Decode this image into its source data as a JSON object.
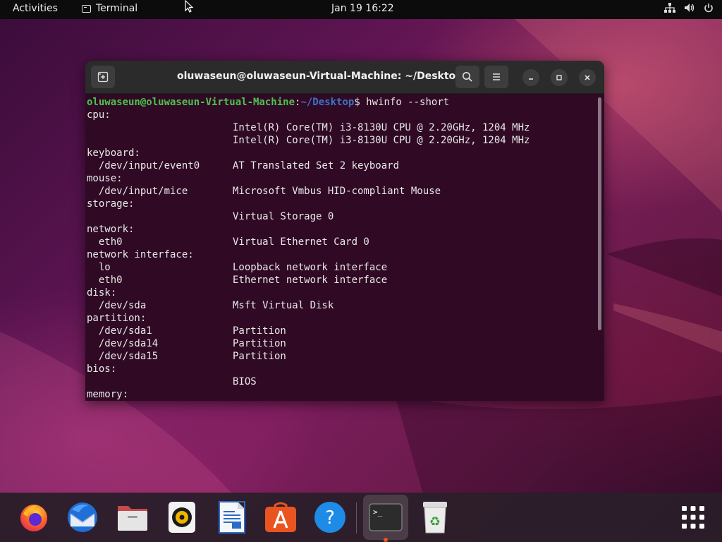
{
  "topbar": {
    "activities": "Activities",
    "app_name": "Terminal",
    "clock": "Jan 19  16:22",
    "tray_icons": [
      "network-icon",
      "volume-icon",
      "power-icon"
    ]
  },
  "window": {
    "title": "oluwaseun@oluwaseun-Virtual-Machine: ~/Desktop"
  },
  "terminal": {
    "prompt_user": "oluwaseun@oluwaseun-Virtual-Machine",
    "prompt_sep": ":",
    "prompt_path": "~/Desktop",
    "prompt_sym": "$ ",
    "command": "hwinfo --short",
    "lines": [
      {
        "device": "cpu:",
        "desc": ""
      },
      {
        "device": "",
        "desc": "Intel(R) Core(TM) i3-8130U CPU @ 2.20GHz, 1204 MHz"
      },
      {
        "device": "",
        "desc": "Intel(R) Core(TM) i3-8130U CPU @ 2.20GHz, 1204 MHz"
      },
      {
        "device": "keyboard:",
        "desc": ""
      },
      {
        "device": "  /dev/input/event0",
        "desc": "AT Translated Set 2 keyboard"
      },
      {
        "device": "mouse:",
        "desc": ""
      },
      {
        "device": "  /dev/input/mice",
        "desc": "Microsoft Vmbus HID-compliant Mouse"
      },
      {
        "device": "storage:",
        "desc": ""
      },
      {
        "device": "",
        "desc": "Virtual Storage 0"
      },
      {
        "device": "network:",
        "desc": ""
      },
      {
        "device": "  eth0",
        "desc": "Virtual Ethernet Card 0"
      },
      {
        "device": "network interface:",
        "desc": ""
      },
      {
        "device": "  lo",
        "desc": "Loopback network interface"
      },
      {
        "device": "  eth0",
        "desc": "Ethernet network interface"
      },
      {
        "device": "disk:",
        "desc": ""
      },
      {
        "device": "  /dev/sda",
        "desc": "Msft Virtual Disk"
      },
      {
        "device": "partition:",
        "desc": ""
      },
      {
        "device": "  /dev/sda1",
        "desc": "Partition"
      },
      {
        "device": "  /dev/sda14",
        "desc": "Partition"
      },
      {
        "device": "  /dev/sda15",
        "desc": "Partition"
      },
      {
        "device": "bios:",
        "desc": ""
      },
      {
        "device": "",
        "desc": "BIOS"
      },
      {
        "device": "memory:",
        "desc": ""
      }
    ]
  },
  "dock": {
    "items": [
      "firefox-icon",
      "thunderbird-icon",
      "files-icon",
      "rhythmbox-icon",
      "libreoffice-writer-icon",
      "software-icon",
      "help-icon",
      "terminal-icon",
      "trash-icon",
      "show-apps-icon"
    ],
    "trash_symbol": "♻",
    "help_symbol": "?",
    "terminal_prompt": ">_"
  },
  "colors": {
    "terminal_bg": "#300a24",
    "prompt_user": "#4ec24e",
    "prompt_path": "#3b73c8",
    "accent": "#e95420"
  }
}
